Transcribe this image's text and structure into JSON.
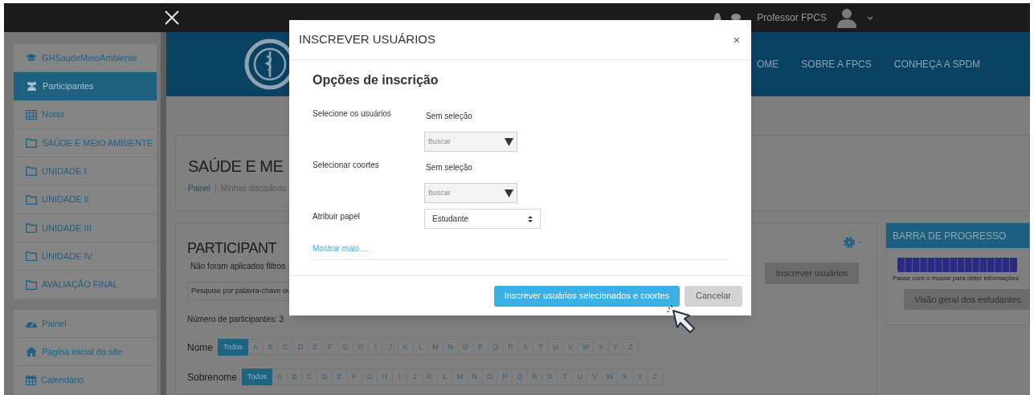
{
  "top_bar": {
    "user_name": "Professor FPCS"
  },
  "sidebar": {
    "groups": [
      [
        {
          "label": "GHSaudeMeioAmbiente",
          "kind": "course",
          "selected": false
        },
        {
          "label": "Participantes",
          "kind": "participants",
          "selected": true
        },
        {
          "label": "Notas",
          "kind": "grades",
          "selected": false
        },
        {
          "label": "SAÚDE E MEIO AMBIENTE",
          "kind": "section",
          "selected": false
        },
        {
          "label": "UNIDADE I",
          "kind": "section",
          "selected": false
        },
        {
          "label": "UNIDADE II",
          "kind": "section",
          "selected": false
        },
        {
          "label": "UNIDADE III",
          "kind": "section",
          "selected": false
        },
        {
          "label": "UNIDADE IV",
          "kind": "section",
          "selected": false
        },
        {
          "label": "AVALIAÇÃO FINAL",
          "kind": "section",
          "selected": false
        }
      ],
      [
        {
          "label": "Painel",
          "kind": "dashboard",
          "selected": false
        },
        {
          "label": "Página inicial do site",
          "kind": "home",
          "selected": false
        },
        {
          "label": "Calendário",
          "kind": "calendar",
          "selected": false
        }
      ]
    ]
  },
  "header": {
    "nav": [
      "OME",
      "SOBRE A FPCS",
      "CONHEÇA A SPDM"
    ]
  },
  "course": {
    "title": "SAÚDE E ME",
    "breadcrumb": [
      "Painel",
      "Minhas disciplinas"
    ]
  },
  "participants": {
    "title": "PARTICIPANT",
    "filters_note": "Não foram aplicados filtros",
    "search_placeholder": "Pesquise por palavra-chave ou",
    "enrol_button": "Inscrever usuários",
    "count": "Número de participantes: 3",
    "initials_filters": [
      {
        "label": "Nome",
        "letters": [
          {
            "label": "Todos",
            "selected": true
          },
          {
            "label": "A",
            "selected": false
          },
          {
            "label": "B",
            "selected": false
          },
          {
            "label": "C",
            "selected": false
          },
          {
            "label": "D",
            "selected": false
          },
          {
            "label": "E",
            "selected": false
          },
          {
            "label": "F",
            "selected": false
          },
          {
            "label": "G",
            "selected": false
          },
          {
            "label": "H",
            "selected": false
          },
          {
            "label": "I",
            "selected": false
          },
          {
            "label": "J",
            "selected": false
          },
          {
            "label": "K",
            "selected": false
          },
          {
            "label": "L",
            "selected": false
          },
          {
            "label": "M",
            "selected": false
          },
          {
            "label": "N",
            "selected": false
          },
          {
            "label": "O",
            "selected": false
          },
          {
            "label": "P",
            "selected": false
          },
          {
            "label": "Q",
            "selected": false
          },
          {
            "label": "R",
            "selected": false
          },
          {
            "label": "S",
            "selected": false
          },
          {
            "label": "T",
            "selected": false
          },
          {
            "label": "U",
            "selected": false
          },
          {
            "label": "V",
            "selected": false
          },
          {
            "label": "W",
            "selected": false
          },
          {
            "label": "X",
            "selected": false
          },
          {
            "label": "Y",
            "selected": false
          },
          {
            "label": "Z",
            "selected": false
          }
        ]
      },
      {
        "label": "Sobrenome",
        "letters": [
          {
            "label": "Todos",
            "selected": true
          },
          {
            "label": "A",
            "selected": false
          },
          {
            "label": "B",
            "selected": false
          },
          {
            "label": "C",
            "selected": false
          },
          {
            "label": "D",
            "selected": false
          },
          {
            "label": "E",
            "selected": false
          },
          {
            "label": "F",
            "selected": false
          },
          {
            "label": "G",
            "selected": false
          },
          {
            "label": "H",
            "selected": false
          },
          {
            "label": "I",
            "selected": false
          },
          {
            "label": "J",
            "selected": false
          },
          {
            "label": "K",
            "selected": false
          },
          {
            "label": "L",
            "selected": false
          },
          {
            "label": "M",
            "selected": false
          },
          {
            "label": "N",
            "selected": false
          },
          {
            "label": "O",
            "selected": false
          },
          {
            "label": "P",
            "selected": false
          },
          {
            "label": "Q",
            "selected": false
          },
          {
            "label": "R",
            "selected": false
          },
          {
            "label": "S",
            "selected": false
          },
          {
            "label": "T",
            "selected": false
          },
          {
            "label": "U",
            "selected": false
          },
          {
            "label": "V",
            "selected": false
          },
          {
            "label": "W",
            "selected": false
          },
          {
            "label": "X",
            "selected": false
          },
          {
            "label": "Y",
            "selected": false
          },
          {
            "label": "Z",
            "selected": false
          }
        ]
      }
    ]
  },
  "progress_block": {
    "title": "BARRA DE PROGRESSO",
    "hint": "Passe com o mouse para obter informações",
    "button": "Visão geral dos estudantes"
  },
  "modal": {
    "title": "INSCREVER USUÁRIOS",
    "close": "×",
    "section_title": "Opções de inscrição",
    "fields": [
      {
        "kind": "autocomplete",
        "label": "Selecione os usuários",
        "selection": "Sem seleção",
        "placeholder": "Buscar"
      },
      {
        "kind": "autocomplete",
        "label": "Selecionar coortes",
        "selection": "Sem seleção",
        "placeholder": "Buscar"
      },
      {
        "kind": "select",
        "label": "Atribuir papel",
        "value": "Estudante"
      }
    ],
    "show_more": "Mostrar mais ...",
    "buttons": [
      {
        "label": "Inscrever usuários selecionados e coortes",
        "kind": "primary"
      },
      {
        "label": "Cancelar",
        "kind": "secondary"
      }
    ]
  }
}
